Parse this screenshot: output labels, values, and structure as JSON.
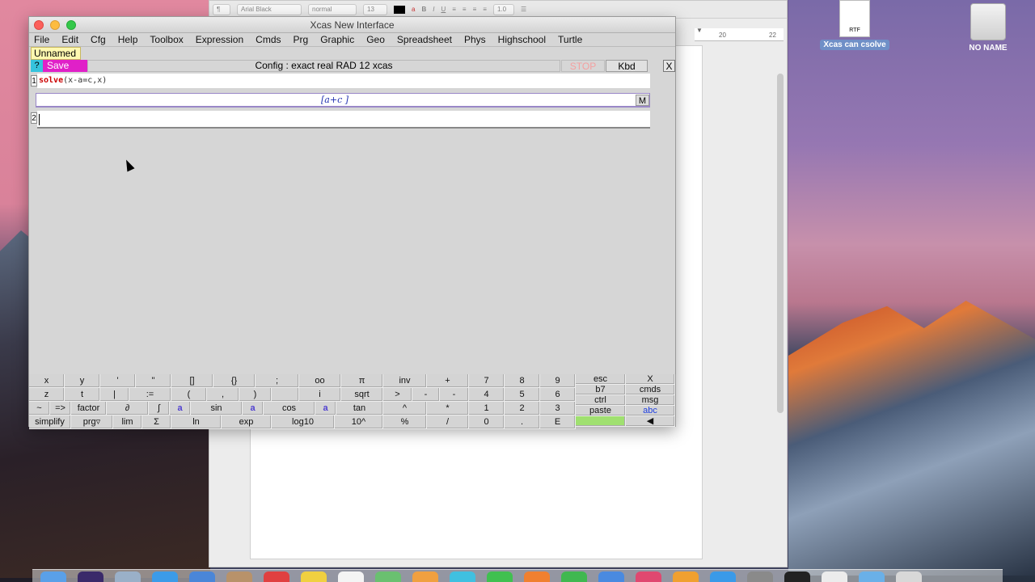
{
  "desktop": {
    "icons": [
      {
        "label": "Xcas can csolve",
        "badge": "RTF"
      },
      {
        "label": "NO NAME"
      }
    ]
  },
  "doc_window": {
    "font_name": "Arial Black",
    "font_style": "normal",
    "font_size": "13",
    "line_spacing": "1.0",
    "ruler_marks": [
      "20",
      "22"
    ]
  },
  "xcas": {
    "title": "Xcas New Interface",
    "menu": [
      "File",
      "Edit",
      "Cfg",
      "Help",
      "Toolbox",
      "Expression",
      "Cmds",
      "Prg",
      "Graphic",
      "Geo",
      "Spreadsheet",
      "Phys",
      "Highschool",
      "Turtle"
    ],
    "tab_label": "Unnamed",
    "help_label": "?",
    "save_label": "Save",
    "config_label": "Config  : exact real RAD 12 xcas",
    "stop_label": "STOP",
    "kbd_label": "Kbd",
    "close_label": "X",
    "session": {
      "level1_num": "1",
      "level1_cmd_kw": "solve",
      "level1_cmd_args": "(x-a=c,x)",
      "level1_answer": "[a+c ]",
      "m_label": "M",
      "level2_num": "2"
    }
  },
  "keyboard": {
    "row1": [
      "x",
      "y",
      "'",
      "\"",
      "[]",
      "{}",
      ";",
      "oo",
      "π",
      "inv",
      "+",
      "7",
      "8",
      "9"
    ],
    "row2": [
      "z",
      "t",
      "|",
      ":=",
      "(",
      ",",
      ")",
      "i",
      "sqrt",
      ">",
      "-",
      "-",
      "4",
      "5",
      "6"
    ],
    "row3": [
      "~",
      "=>",
      "factor",
      "∂",
      "∫",
      "a",
      "sin",
      "a",
      "cos",
      "a",
      "tan",
      "^",
      "*",
      "1",
      "2",
      "3"
    ],
    "row4": [
      "simplify",
      "prg▿",
      "lim",
      "Σ",
      "ln",
      "exp",
      "log10",
      "10^",
      "%",
      "/",
      "0",
      ".",
      "E"
    ],
    "side_left": [
      "esc",
      "b7",
      "ctrl",
      "paste"
    ],
    "side_right": [
      "X",
      "cmds",
      "msg",
      "abc"
    ]
  }
}
